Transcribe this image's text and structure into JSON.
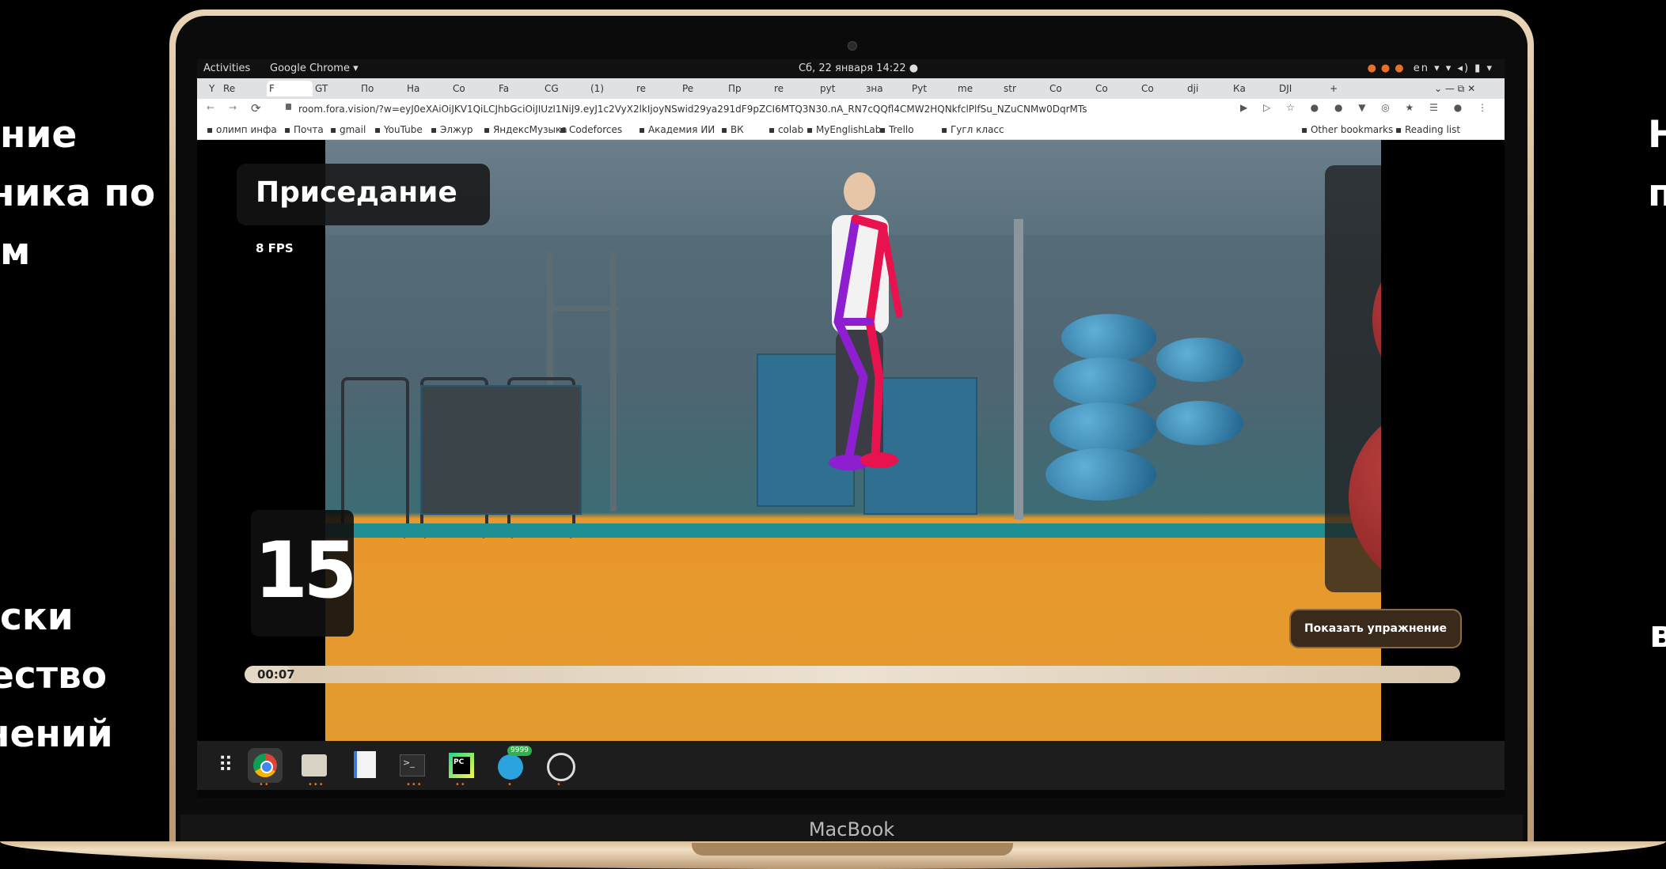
{
  "side_text": {
    "left_top": [
      "ние",
      "ника по",
      "м"
    ],
    "left_bottom": [
      "ски",
      "ество",
      "нений"
    ],
    "right_top": [
      "Н",
      "п"
    ],
    "right_bottom": [
      "в"
    ]
  },
  "laptop": {
    "brand": "MacBook"
  },
  "system_bar": {
    "activities": "Activities",
    "app": "Google Chrome ▾",
    "clock": "Сб, 22 января  14:22  ●",
    "tray": "en ▾"
  },
  "browser": {
    "tabs": [
      "Re",
      "F",
      "GT",
      "По",
      "На",
      "Co",
      "Fa",
      "CG",
      "(1)",
      "re",
      "Pe",
      "Пр",
      "re",
      "pyt",
      "зна",
      "Pyt",
      "me",
      "str",
      "Co",
      "Co",
      "Co",
      "dji",
      "Ка",
      "DJI"
    ],
    "active_tab_index": 1,
    "url": "room.fora.vision/?w=eyJ0eXAiOiJKV1QiLCJhbGciOiJIUzI1NiJ9.eyJ1c2VyX2lkIjoyNSwid29ya291dF9pZCI6MTQ3N30.nA_RN7cQQfl4CMW2HQNkfclPlfSu_NZuCNMw0DqrMTs",
    "bookmarks": [
      "олимп инфа",
      "Почта",
      "gmail",
      "YouTube",
      "Элжур",
      "ЯндексМузыка",
      "Codeforces",
      "Академия ИИ",
      "ВК",
      "colab",
      "MyEnglishLab",
      "Trello",
      "Гугл класс",
      "Other bookmarks",
      "Reading list"
    ]
  },
  "workout": {
    "exercise_title": "Приседание",
    "fps": "8 FPS",
    "rep_count": "15",
    "show_button": "Показать упражнение",
    "timer": "00:07",
    "progress": 0.04
  },
  "dock": {
    "telegram_badge": "9999",
    "items": [
      "apps-grid-icon",
      "chrome-icon",
      "files-icon",
      "docs-icon",
      "terminal-icon",
      "pycharm-icon",
      "telegram-icon",
      "obs-icon"
    ]
  },
  "colors": {
    "skeleton_left": "#8e1fd1",
    "skeleton_right": "#e8124f",
    "floor": "#e9982a",
    "accent": "#e5702b"
  }
}
